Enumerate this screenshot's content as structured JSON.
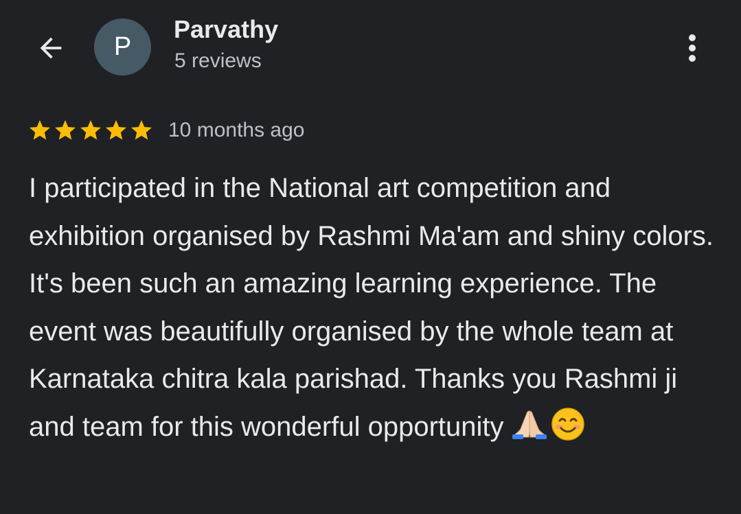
{
  "header": {
    "back_icon": "arrow-back-icon",
    "avatar_letter": "P",
    "avatar_color": "#455a64",
    "user_name": "Parvathy",
    "review_count": "5 reviews",
    "more_icon": "more-vert-icon"
  },
  "review": {
    "rating": 5,
    "rating_max": 5,
    "star_color": "#fbbc04",
    "time_ago": "10 months ago",
    "text": "I participated in the National art competition and exhibition organised by Rashmi Ma'am and shiny colors. It's been such an amazing learning experience. The event was beautifully organised by the whole team at Karnataka chitra kala parishad. Thanks you Rashmi ji and team for this wonderful opportunity",
    "emojis": [
      "folded-hands-emoji",
      "smiling-face-emoji"
    ]
  }
}
